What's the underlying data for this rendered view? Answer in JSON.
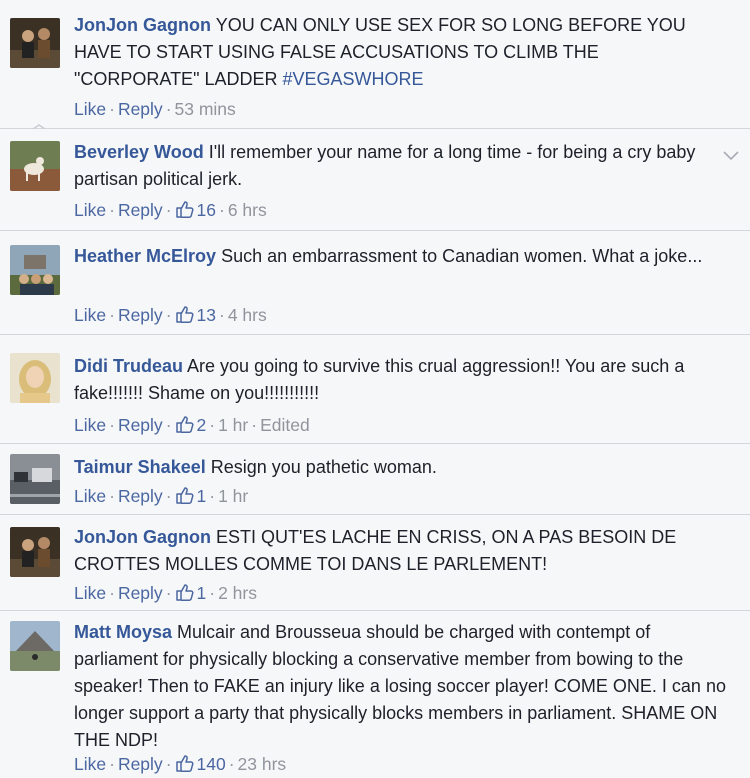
{
  "actions": {
    "like": "Like",
    "reply": "Reply",
    "dot": "·"
  },
  "comments": [
    {
      "author": "JonJon Gagnon",
      "text": "YOU CAN ONLY USE SEX FOR SO LONG BEFORE YOU HAVE TO START USING FALSE ACCUSATIONS TO CLIMB THE \"CORPORATE\" LADDER",
      "hashtag": "#VEGASWHORE",
      "likes": "",
      "time": "53 mins",
      "edited": ""
    },
    {
      "author": "Beverley Wood",
      "text": "I'll remember your name for a long time - for being a cry baby partisan political jerk.",
      "likes": "16",
      "time": "6 hrs",
      "edited": ""
    },
    {
      "author": "Heather McElroy",
      "text": "Such an embarrassment to Canadian women. What a joke...",
      "likes": "13",
      "time": "4 hrs",
      "edited": ""
    },
    {
      "author": "Didi Trudeau",
      "text": "Are you going to survive this crual aggression!! You are such a fake!!!!!!! Shame on you!!!!!!!!!!!",
      "likes": "2",
      "time": "1 hr",
      "edited": "Edited"
    },
    {
      "author": "Taimur Shakeel",
      "text": "Resign you pathetic woman.",
      "likes": "1",
      "time": "1 hr",
      "edited": ""
    },
    {
      "author": "JonJon Gagnon",
      "text": "ESTI QUT'ES LACHE EN CRISS, ON A PAS BESOIN DE CROTTES MOLLES COMME TOI DANS LE PARLEMENT!",
      "likes": "1",
      "time": "2 hrs",
      "edited": ""
    },
    {
      "author": "Matt Moysa",
      "text": "Mulcair and Brousseua should be charged with contempt of parliament for physically blocking a conservative member from bowing to the speaker! Then to FAKE an injury like a losing soccer player! COME ONE. I can no longer support a party that physically blocks members in parliament. SHAME ON THE NDP!",
      "likes": "140",
      "time": "23 hrs",
      "edited": ""
    }
  ]
}
